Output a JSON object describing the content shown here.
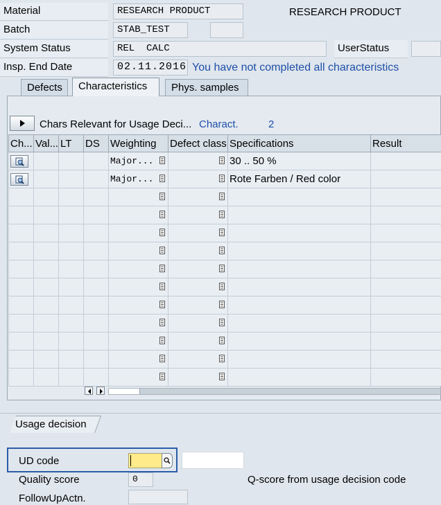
{
  "header": {
    "material_label": "Material",
    "material_value": "RESEARCH PRODUCT",
    "material_desc": "RESEARCH PRODUCT",
    "batch_label": "Batch",
    "batch_value": "STAB_TEST",
    "status_label": "System Status",
    "status_value": "REL  CALC",
    "userstatus_label": "UserStatus",
    "insp_end_label": "Insp. End Date",
    "insp_end_value": "02.11.2016",
    "info_message": "You have not completed all characteristics"
  },
  "tabs": [
    {
      "label": "Defects",
      "active": false
    },
    {
      "label": "Characteristics",
      "active": true
    },
    {
      "label": "Phys. samples",
      "active": false
    }
  ],
  "chars_bar": {
    "title": "Chars Relevant for Usage Deci...",
    "charact_link": "Charact.",
    "count": "2"
  },
  "table": {
    "columns": [
      "Ch...",
      "Val...",
      "LT",
      "DS",
      "Weighting",
      "Defect class",
      "Specifications",
      "Result"
    ],
    "rows": [
      {
        "weighting": "Major...",
        "defect_class": "",
        "spec": "30 .. 50 %",
        "result": "",
        "has_button": true
      },
      {
        "weighting": "Major...",
        "defect_class": "",
        "spec": "Rote Farben / Red color",
        "result": "",
        "has_button": true
      }
    ],
    "empty_rows": 11
  },
  "usage_decision": {
    "section_label": "Usage decision",
    "ud_code_label": "UD code",
    "ud_code_value": "",
    "quality_score_label": "Quality score",
    "quality_score_value": "0",
    "qscore_text": "Q-score from usage decision code",
    "followup_label": "FollowUpActn."
  },
  "icons": [
    "details-icon",
    "f4-help-icon",
    "expand-arrow-icon",
    "scroll-left-icon",
    "scroll-right-icon",
    "search-icon"
  ]
}
